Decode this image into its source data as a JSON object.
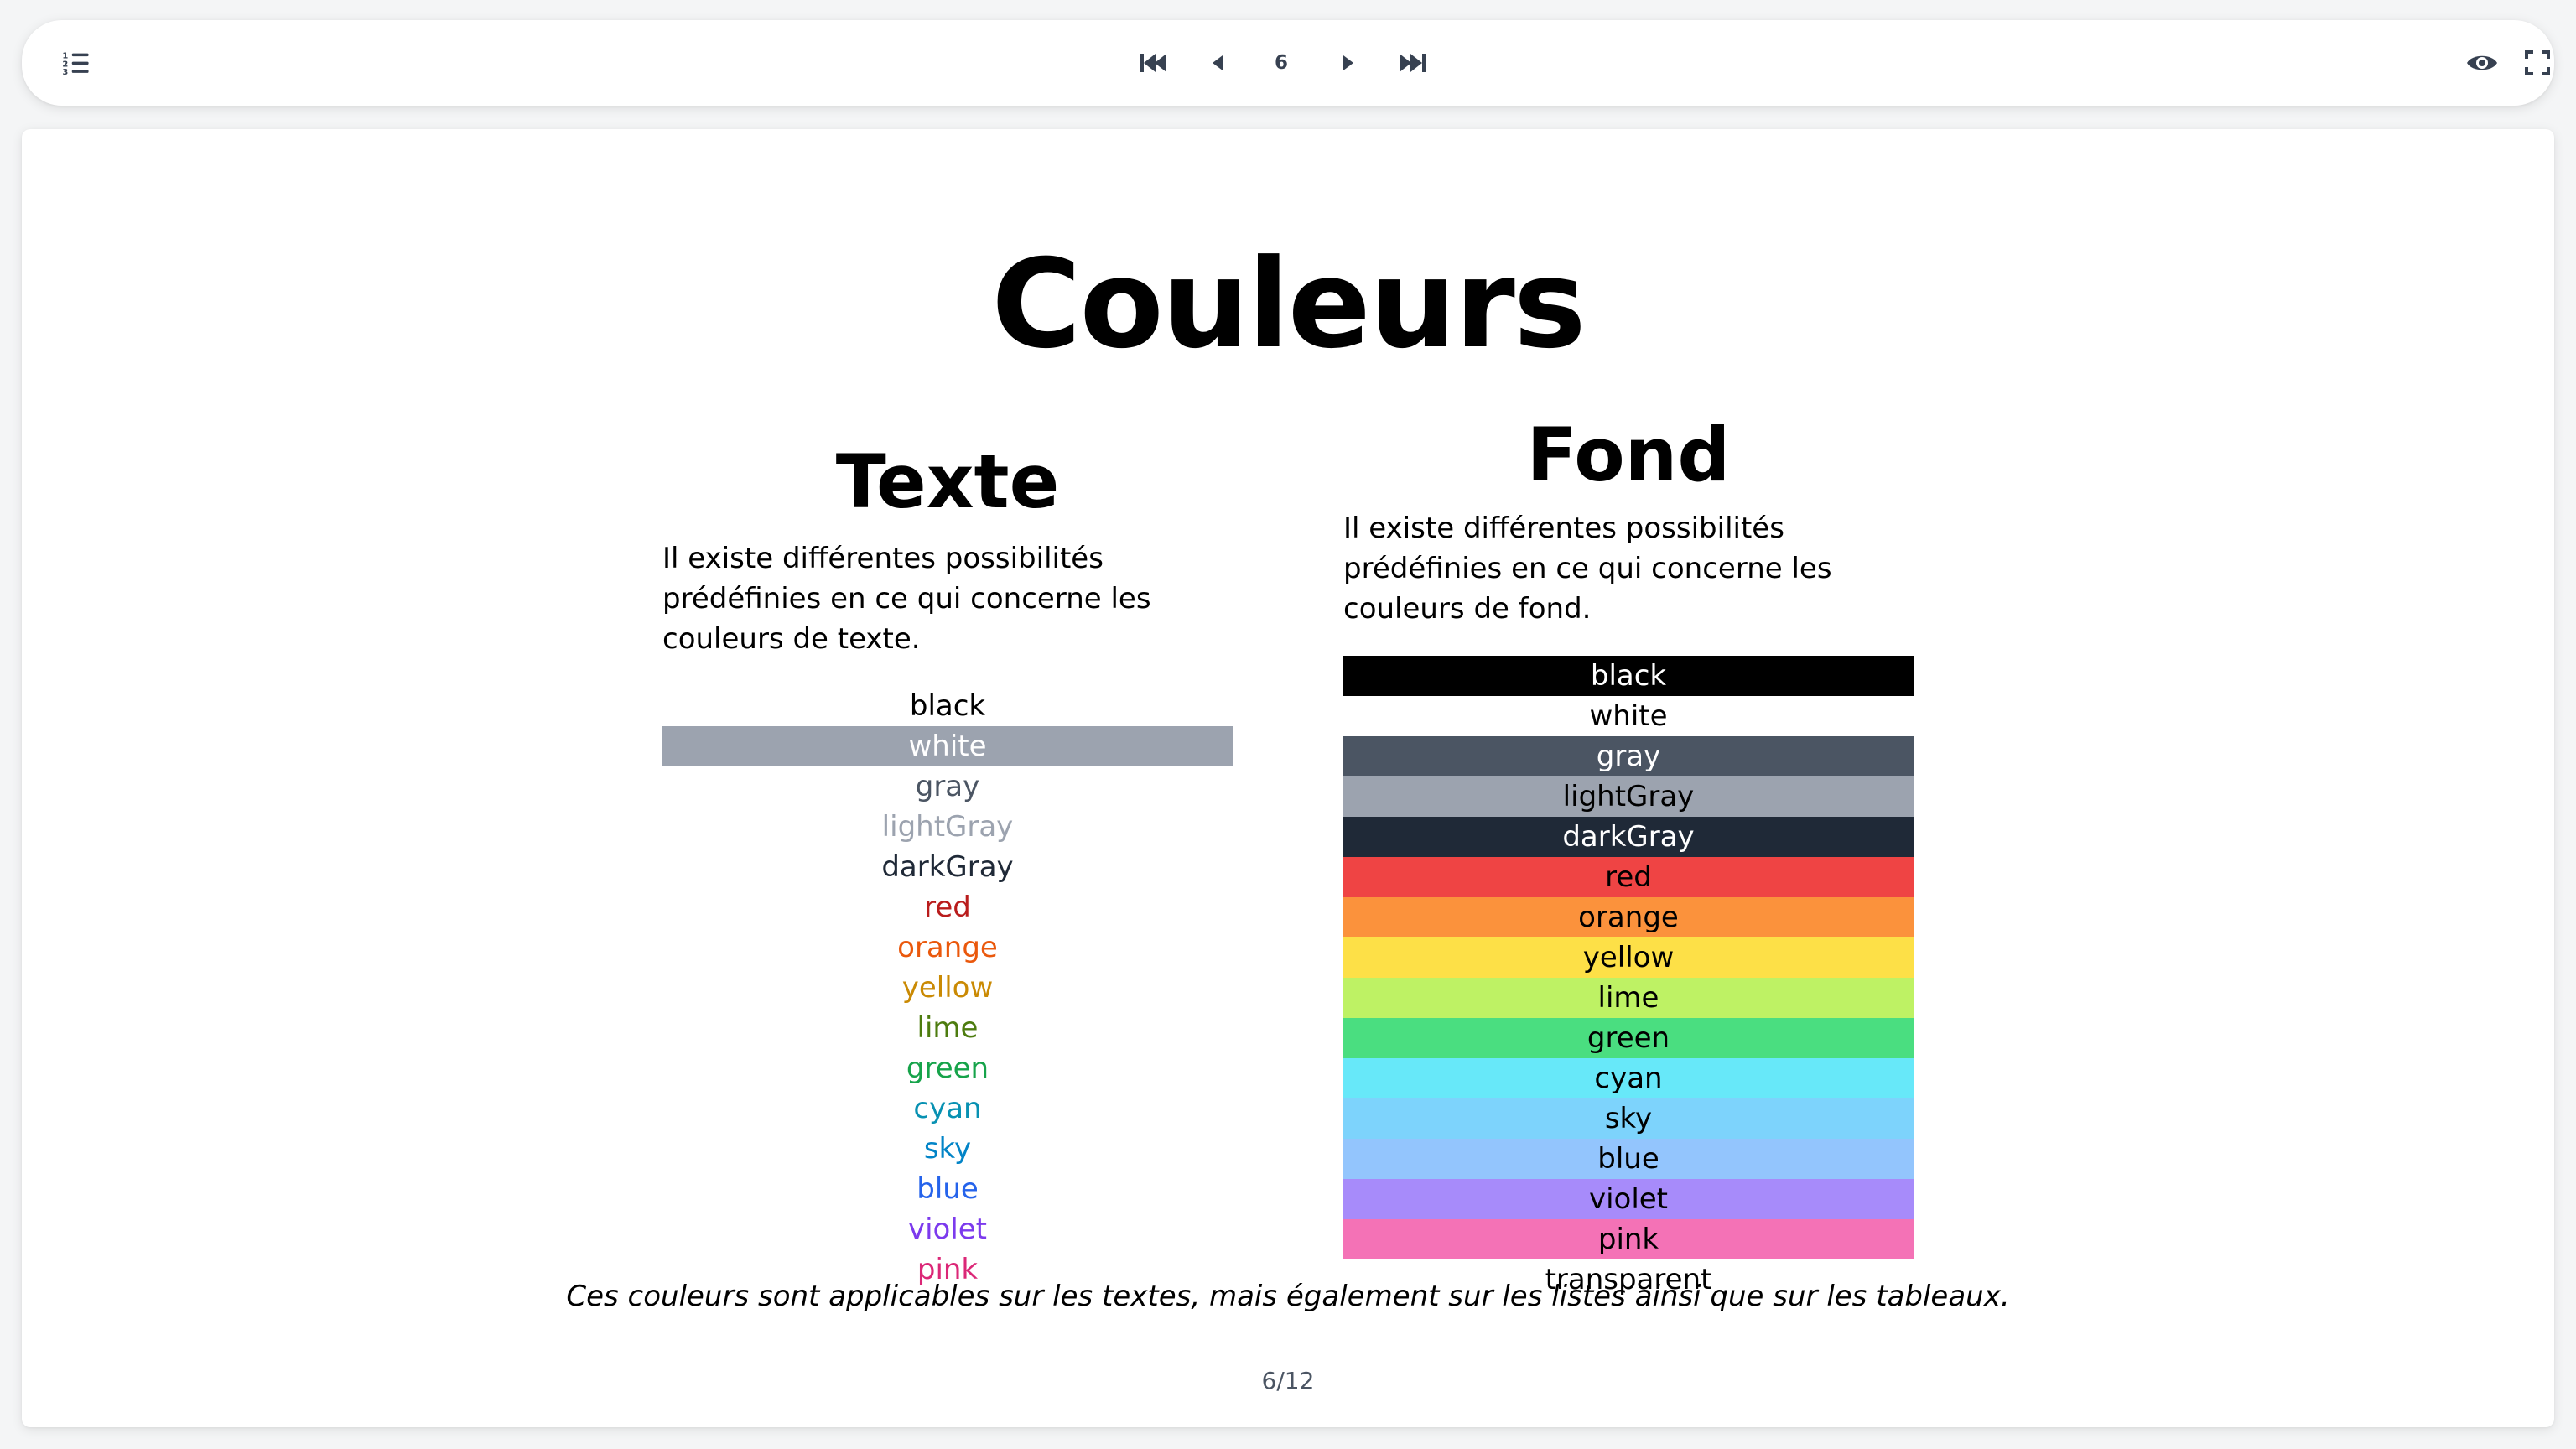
{
  "toolbar": {
    "current_page": "6",
    "icons": [
      "list-ordered-icon",
      "skip-first-icon",
      "previous-icon",
      "next-icon",
      "skip-last-icon",
      "eye-icon",
      "fullscreen-icon"
    ]
  },
  "slide": {
    "title": "Couleurs",
    "text_section": {
      "heading": "Texte",
      "description": "Il existe différentes possibilités prédéfinies en ce qui concerne les couleurs de texte.",
      "items": [
        {
          "label": "black",
          "color": "#000000",
          "highlight": ""
        },
        {
          "label": "white",
          "color": "#ffffff",
          "highlight": "#9ca3af"
        },
        {
          "label": "gray",
          "color": "#4b5563",
          "highlight": ""
        },
        {
          "label": "lightGray",
          "color": "#9ca3af",
          "highlight": ""
        },
        {
          "label": "darkGray",
          "color": "#1f2937",
          "highlight": ""
        },
        {
          "label": "red",
          "color": "#b91c1c",
          "highlight": ""
        },
        {
          "label": "orange",
          "color": "#ea580c",
          "highlight": ""
        },
        {
          "label": "yellow",
          "color": "#ca8a04",
          "highlight": ""
        },
        {
          "label": "lime",
          "color": "#4d7c0f",
          "highlight": ""
        },
        {
          "label": "green",
          "color": "#16a34a",
          "highlight": ""
        },
        {
          "label": "cyan",
          "color": "#0891b2",
          "highlight": ""
        },
        {
          "label": "sky",
          "color": "#0284c7",
          "highlight": ""
        },
        {
          "label": "blue",
          "color": "#2563eb",
          "highlight": ""
        },
        {
          "label": "violet",
          "color": "#7c3aed",
          "highlight": ""
        },
        {
          "label": "pink",
          "color": "#db2777",
          "highlight": ""
        }
      ]
    },
    "background_section": {
      "heading": "Fond",
      "description": "Il existe différentes possibilités prédéfinies en ce qui concerne les couleurs de fond.",
      "items": [
        {
          "label": "black",
          "bg": "#000000",
          "color": "#ffffff"
        },
        {
          "label": "white",
          "bg": "#ffffff",
          "color": "#000000"
        },
        {
          "label": "gray",
          "bg": "#4b5563",
          "color": "#ffffff"
        },
        {
          "label": "lightGray",
          "bg": "#9ca3af",
          "color": "#000000"
        },
        {
          "label": "darkGray",
          "bg": "#1f2937",
          "color": "#ffffff"
        },
        {
          "label": "red",
          "bg": "#ef4444",
          "color": "#000000"
        },
        {
          "label": "orange",
          "bg": "#fb923c",
          "color": "#000000"
        },
        {
          "label": "yellow",
          "bg": "#fde047",
          "color": "#000000"
        },
        {
          "label": "lime",
          "bg": "#bef264",
          "color": "#000000"
        },
        {
          "label": "green",
          "bg": "#4ade80",
          "color": "#000000"
        },
        {
          "label": "cyan",
          "bg": "#67e8f9",
          "color": "#000000"
        },
        {
          "label": "sky",
          "bg": "#7dd3fc",
          "color": "#000000"
        },
        {
          "label": "blue",
          "bg": "#93c5fd",
          "color": "#000000"
        },
        {
          "label": "violet",
          "bg": "#a78bfa",
          "color": "#000000"
        },
        {
          "label": "pink",
          "bg": "#f472b6",
          "color": "#000000"
        },
        {
          "label": "transparent",
          "bg": "transparent",
          "color": "#000000"
        }
      ]
    },
    "footer_note": "Ces couleurs sont applicables sur les textes, mais également sur les listes ainsi que sur les tableaux.",
    "page_counter": "6/12"
  }
}
